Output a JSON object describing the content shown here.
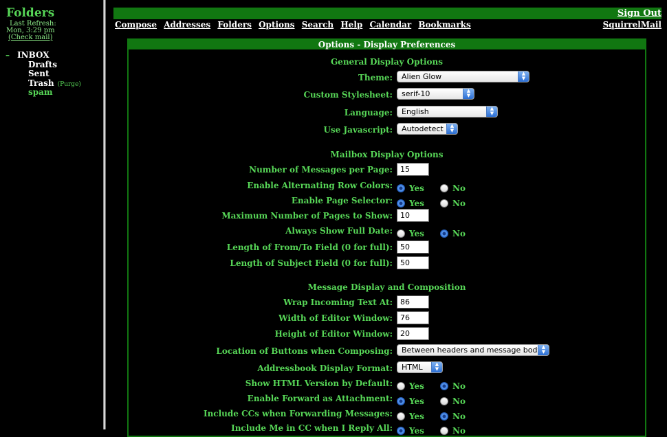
{
  "left": {
    "title": "Folders",
    "last_refresh_label": "Last Refresh:",
    "refresh_time": "Mon, 3:29 pm",
    "check_mail": "(Check mail)",
    "folders": [
      "INBOX",
      "Drafts",
      "Sent",
      "Trash",
      "spam"
    ],
    "purge": "(Purge)"
  },
  "top": {
    "sign_out": "Sign Out",
    "menu": [
      "Compose",
      "Addresses",
      "Folders",
      "Options",
      "Search",
      "Help",
      "Calendar",
      "Bookmarks"
    ],
    "brand_link": "SquirrelMail"
  },
  "panel": {
    "title": "Options - Display Preferences",
    "general": {
      "title": "General Display Options",
      "theme_label": "Theme:",
      "theme_value": "Alien Glow",
      "stylesheet_label": "Custom Stylesheet:",
      "stylesheet_value": "serif-10",
      "language_label": "Language:",
      "language_value": "English",
      "javascript_label": "Use Javascript:",
      "javascript_value": "Autodetect"
    },
    "mailbox": {
      "title": "Mailbox Display Options",
      "per_page_label": "Number of Messages per Page:",
      "per_page_value": "15",
      "alt_rows_label": "Enable Alternating Row Colors:",
      "page_selector_label": "Enable Page Selector:",
      "max_pages_label": "Maximum Number of Pages to Show:",
      "max_pages_value": "10",
      "full_date_label": "Always Show Full Date:",
      "from_len_label": "Length of From/To Field (0 for full):",
      "from_len_value": "50",
      "subject_len_label": "Length of Subject Field (0 for full):",
      "subject_len_value": "50"
    },
    "message": {
      "title": "Message Display and Composition",
      "wrap_label": "Wrap Incoming Text At:",
      "wrap_value": "86",
      "editor_width_label": "Width of Editor Window:",
      "editor_width_value": "76",
      "editor_height_label": "Height of Editor Window:",
      "editor_height_value": "20",
      "buttons_location_label": "Location of Buttons when Composing:",
      "buttons_location_value": "Between headers and message body",
      "addressbook_format_label": "Addressbook Display Format:",
      "addressbook_format_value": "HTML",
      "html_default_label": "Show HTML Version by Default:",
      "forward_attach_label": "Enable Forward as Attachment:",
      "include_ccs_label": "Include CCs when Forwarding Messages:",
      "include_me_label": "Include Me in CC when I Reply All:"
    },
    "yes": "Yes",
    "no": "No"
  }
}
